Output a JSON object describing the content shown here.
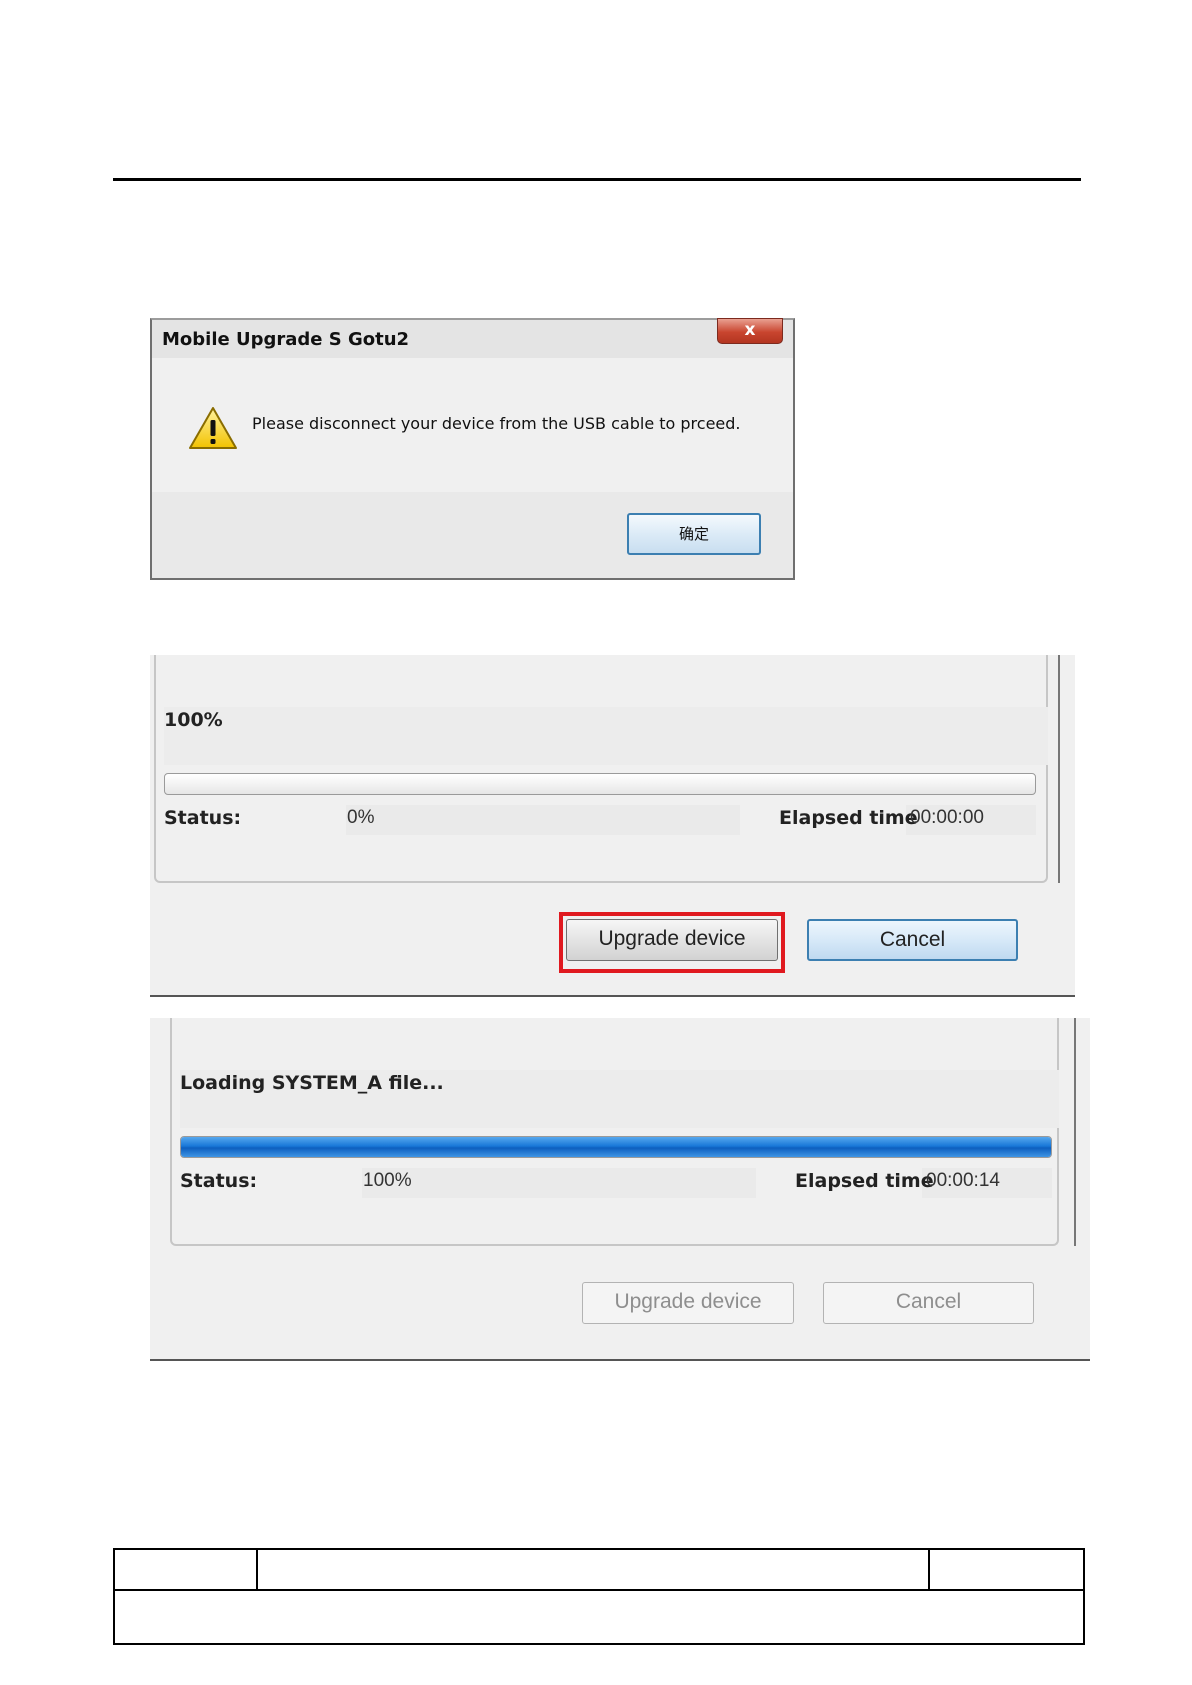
{
  "dialog": {
    "title": "Mobile Upgrade S Gotu2",
    "close_glyph": "x",
    "icon": "warning-triangle-icon",
    "message": "Please disconnect your device from the USB cable to prceed.",
    "ok_label": "确定"
  },
  "panel_ready": {
    "heading": "100%",
    "progress": 0,
    "status_label": "Status:",
    "status_value": "0%",
    "elapsed_label": "Elapsed time",
    "elapsed_value": "00:00:00",
    "upgrade_label": "Upgrade device",
    "cancel_label": "Cancel",
    "highlight_color": "#e0191f"
  },
  "panel_loading": {
    "heading": "Loading SYSTEM_A file...",
    "progress": 1.0,
    "status_label": "Status:",
    "status_value": "100%",
    "elapsed_label": "Elapsed time",
    "elapsed_value": "00:00:14",
    "upgrade_label": "Upgrade device",
    "cancel_label": "Cancel"
  }
}
